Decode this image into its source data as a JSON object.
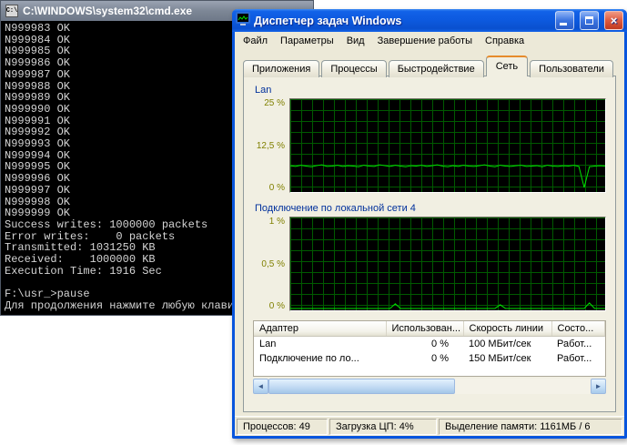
{
  "console": {
    "title": "C:\\WINDOWS\\system32\\cmd.exe",
    "lines": [
      "N999983 OK",
      "N999984 OK",
      "N999985 OK",
      "N999986 OK",
      "N999987 OK",
      "N999988 OK",
      "N999989 OK",
      "N999990 OK",
      "N999991 OK",
      "N999992 OK",
      "N999993 OK",
      "N999994 OK",
      "N999995 OK",
      "N999996 OK",
      "N999997 OK",
      "N999998 OK",
      "N999999 OK",
      "Success writes: 1000000 packets",
      "Error writes:    0 packets",
      "Transmitted: 1031250 KB",
      "Received:    1000000 KB",
      "Execution Time: 1916 Sec",
      "",
      "F:\\usr_>pause",
      "Для продолжения нажмите любую клавишу . . ."
    ]
  },
  "taskmgr": {
    "title": "Диспетчер задач Windows",
    "menu": [
      "Файл",
      "Параметры",
      "Вид",
      "Завершение работы",
      "Справка"
    ],
    "tabs": [
      {
        "label": "Приложения",
        "active": false
      },
      {
        "label": "Процессы",
        "active": false
      },
      {
        "label": "Быстродействие",
        "active": false
      },
      {
        "label": "Сеть",
        "active": true
      },
      {
        "label": "Пользователи",
        "active": false
      }
    ],
    "colors": {
      "graph_line": "#00E000",
      "graph_grid": "#005A00",
      "titlebar_blue": "#0D5AE0"
    },
    "graphs": [
      {
        "label": "Lan",
        "ticks": [
          "25 %",
          "12,5 %",
          "0 %"
        ],
        "max": 25,
        "values": [
          7.1,
          6.9,
          7.2,
          7.0,
          6.8,
          7.1,
          7.3,
          6.9,
          7.0,
          7.2,
          6.9,
          7.1,
          7.0,
          6.8,
          7.2,
          7.0,
          6.9,
          7.3,
          7.1,
          6.9,
          7.2,
          7.0,
          6.8,
          7.1,
          7.0,
          7.2,
          6.9,
          7.1,
          7.3,
          7.0,
          6.8,
          7.1,
          6.9,
          7.2,
          7.0,
          6.9,
          7.1,
          7.3,
          7.0,
          6.8,
          7.2,
          7.0,
          6.9,
          7.1,
          7.2,
          6.9,
          7.0,
          7.1,
          6.8,
          7.2,
          7.0,
          6.9,
          7.1,
          7.0,
          7.2,
          6.9,
          1.2,
          6.8,
          7.0,
          7.1,
          7.0
        ]
      },
      {
        "label": "Подключение по локальной сети 4",
        "ticks": [
          "1 %",
          "0,5 %",
          "0 %"
        ],
        "max": 1,
        "values": [
          0.02,
          0.02,
          0.02,
          0.02,
          0.02,
          0.02,
          0.02,
          0.02,
          0.02,
          0.02,
          0.02,
          0.02,
          0.02,
          0.02,
          0.02,
          0.02,
          0.02,
          0.02,
          0.02,
          0.02,
          0.07,
          0.02,
          0.02,
          0.02,
          0.02,
          0.02,
          0.02,
          0.02,
          0.02,
          0.02,
          0.02,
          0.02,
          0.02,
          0.02,
          0.02,
          0.02,
          0.02,
          0.02,
          0.02,
          0.02,
          0.06,
          0.02,
          0.02,
          0.02,
          0.02,
          0.02,
          0.02,
          0.02,
          0.02,
          0.02,
          0.02,
          0.02,
          0.02,
          0.02,
          0.02,
          0.02,
          0.02,
          0.08,
          0.02,
          0.02,
          0.02
        ]
      }
    ],
    "table": {
      "headers": [
        "Адаптер",
        "Использован...",
        "Скорость линии",
        "Состо..."
      ],
      "rows": [
        [
          "Lan",
          "0 %",
          "100 МБит/сек",
          "Работ..."
        ],
        [
          "Подключение по ло...",
          "0 %",
          "150 МБит/сек",
          "Работ..."
        ]
      ]
    },
    "statusbar": [
      "Процессов: 49",
      "Загрузка ЦП: 4%",
      "Выделение памяти: 1161МБ / 6"
    ]
  }
}
